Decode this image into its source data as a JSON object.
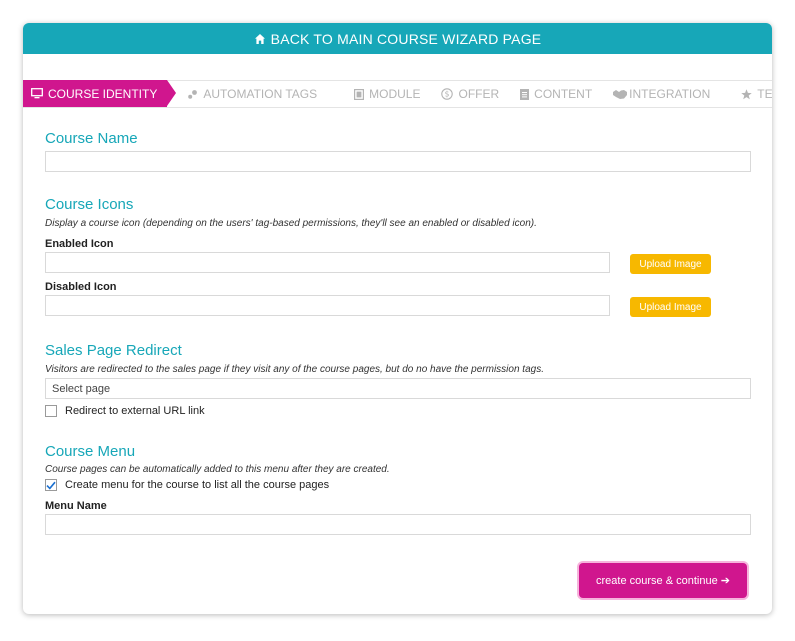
{
  "header": {
    "back_label": "BACK TO MAIN COURSE WIZARD PAGE"
  },
  "tabs": [
    {
      "label": "COURSE IDENTITY",
      "icon": "monitor-icon",
      "active": true
    },
    {
      "label": "AUTOMATION TAGS",
      "icon": "tags-icon"
    },
    {
      "label": "MODULE",
      "icon": "module-icon"
    },
    {
      "label": "OFFER",
      "icon": "dollar-icon"
    },
    {
      "label": "CONTENT",
      "icon": "document-icon"
    },
    {
      "label": "INTEGRATION",
      "icon": "handshake-icon"
    },
    {
      "label": "TESTING",
      "icon": "star-icon"
    }
  ],
  "course_name": {
    "title": "Course Name",
    "value": ""
  },
  "course_icons": {
    "title": "Course Icons",
    "description": "Display a course icon (depending on the users' tag-based permissions, they'll see an enabled or disabled icon).",
    "enabled_label": "Enabled Icon",
    "disabled_label": "Disabled Icon",
    "upload_label": "Upload Image"
  },
  "sales_redirect": {
    "title": "Sales Page Redirect",
    "description": "Visitors are redirected to the sales page if they visit any of the course pages, but do no have the permission tags.",
    "select_placeholder": "Select page",
    "external_label": "Redirect to external URL link",
    "external_checked": false
  },
  "course_menu": {
    "title": "Course Menu",
    "description": "Course pages can be automatically added to this menu after they are created.",
    "create_label": "Create menu for the course to list all the course pages",
    "create_checked": true,
    "menu_name_label": "Menu Name"
  },
  "submit": {
    "label": "create course & continue ➔"
  },
  "colors": {
    "accent": "#17a7b8",
    "active_tab": "#d0168e",
    "upload": "#f7b800"
  }
}
